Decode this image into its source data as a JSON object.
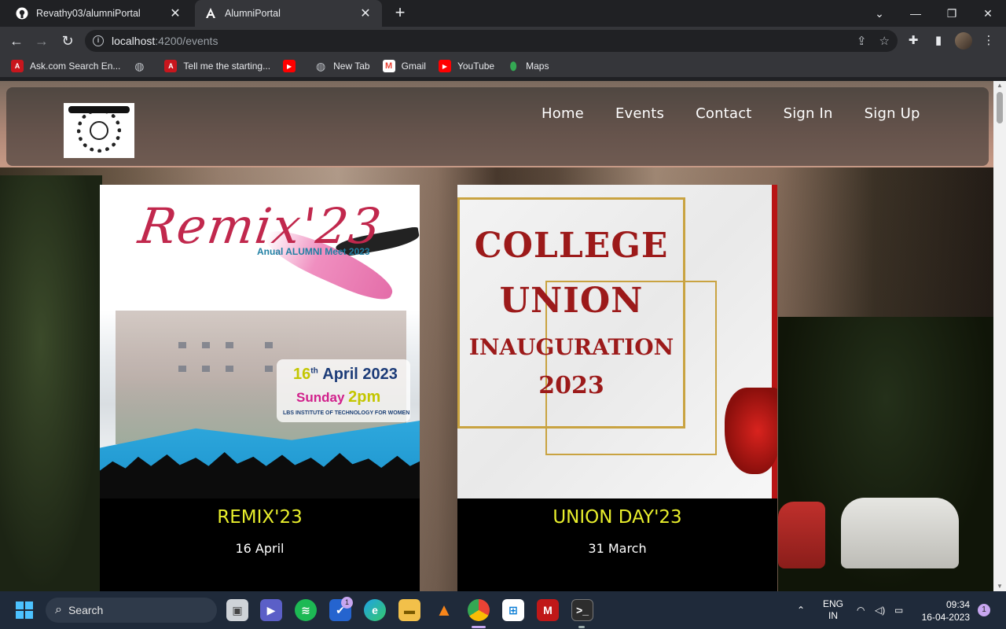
{
  "browser": {
    "tabs": [
      {
        "title": "Revathy03/alumniPortal",
        "icon": "github-icon"
      },
      {
        "title": "AlumniPortal",
        "icon": "angular-icon"
      }
    ],
    "address": {
      "host": "localhost",
      "path": ":4200/events"
    },
    "bookmarks": [
      {
        "label": "Ask.com Search En...",
        "icon": "ask-icon"
      },
      {
        "label": "",
        "icon": "globe-icon"
      },
      {
        "label": "Tell me the starting...",
        "icon": "ask-icon"
      },
      {
        "label": "",
        "icon": "youtube-icon"
      },
      {
        "label": "New Tab",
        "icon": "globe-icon"
      },
      {
        "label": "Gmail",
        "icon": "gmail-icon"
      },
      {
        "label": "YouTube",
        "icon": "youtube-icon"
      },
      {
        "label": "Maps",
        "icon": "maps-icon"
      }
    ]
  },
  "site": {
    "nav": [
      "Home",
      "Events",
      "Contact",
      "Sign In",
      "Sign Up"
    ],
    "events": [
      {
        "title": "REMIX'23",
        "date": "16 April",
        "poster": {
          "heading": "Remix'23",
          "subheading": "Anual ALUMNI Meet 2023",
          "date_day": "16",
          "date_sup": "th",
          "date_rest": "April 2023",
          "weekday": "Sunday",
          "time": "2pm",
          "venue": "LBS INSTITUTE OF TECHNOLOGY FOR WOMEN"
        }
      },
      {
        "title": "UNION DAY'23",
        "date": "31 March",
        "poster": {
          "line1": "COLLEGE",
          "line2": "UNION",
          "line3": "INAUGURATION",
          "line4": "2023"
        }
      }
    ]
  },
  "taskbar": {
    "search_placeholder": "Search",
    "badge_count": "1",
    "lang_top": "ENG",
    "lang_bottom": "IN",
    "time": "09:34",
    "date": "16-04-2023",
    "notifications": "1"
  },
  "colors": {
    "event_title": "#e8ee2c",
    "chrome_bg": "#202124",
    "toolbar_bg": "#35363a"
  }
}
